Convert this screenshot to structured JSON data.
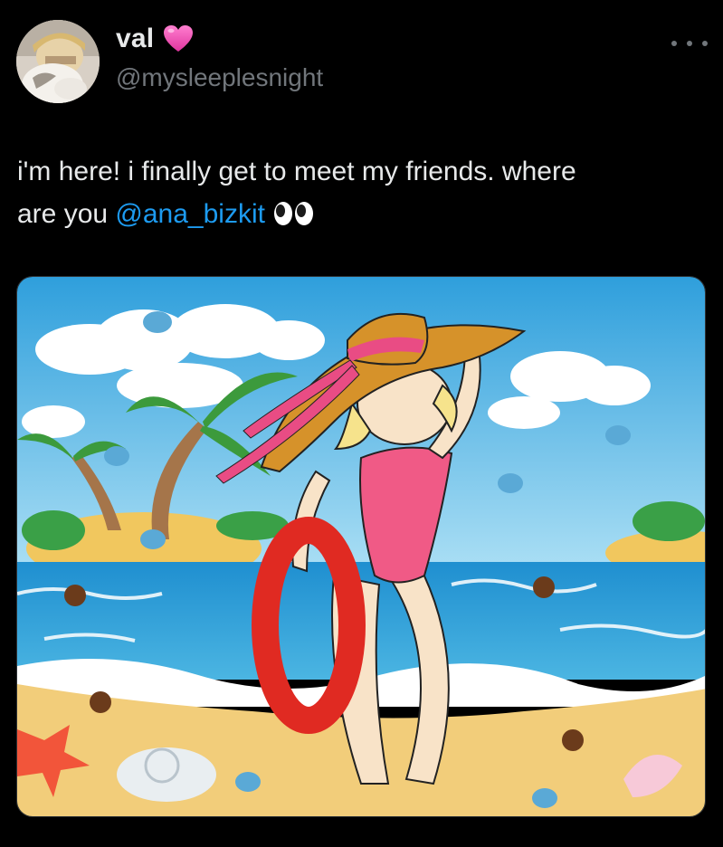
{
  "author": {
    "display_name": "val",
    "handle": "@mysleeplesnight",
    "badge_icon": "pink-heart-icon",
    "avatar_icon": "avatar-photo"
  },
  "menu": {
    "icon": "more-options-icon"
  },
  "tweet": {
    "text_line1": "i'm here! i finally get to meet my friends. where",
    "text_line2_prefix": "are you ",
    "mention": "@ana_bizkit",
    "emoji_icon": "eyes-emoji-icon"
  },
  "media": {
    "type": "cartoon-illustration",
    "description_icon": "beach-cartoon-image"
  },
  "colors": {
    "background": "#000000",
    "text": "#e7e9ea",
    "secondary": "#71767b",
    "link": "#1d9bf0",
    "heart": "#f04fb0"
  }
}
